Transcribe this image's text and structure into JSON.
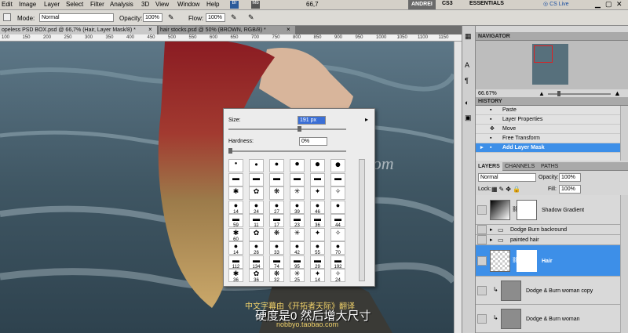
{
  "menu": [
    "Edit",
    "Image",
    "Layer",
    "Select",
    "Filter",
    "Analysis",
    "3D",
    "View",
    "Window",
    "Help"
  ],
  "app": {
    "zoom": "66,7",
    "workspace": "ANDREI",
    "cs3": "CS3",
    "essentials": "ESSENTIALS",
    "cslive": "CS Live"
  },
  "options": {
    "mode_label": "Mode:",
    "mode_value": "Normal",
    "opacity_label": "Opacity:",
    "opacity_value": "100%",
    "flow_label": "Flow:",
    "flow_value": "100%"
  },
  "tabs": [
    "opeless PSD BOX.psd @ 66,7% (Hair, Layer Mask/8) *",
    "hair stocks.psd @ 50% (BROWN, RGB/8) *"
  ],
  "ruler": [
    "100",
    "150",
    "200",
    "250",
    "300",
    "350",
    "400",
    "450",
    "500",
    "550",
    "600",
    "650",
    "700",
    "750",
    "800",
    "850",
    "900",
    "950",
    "1000",
    "1050",
    "1100",
    "1150"
  ],
  "navigator": {
    "title": "NAVIGATOR",
    "zoom": "66.67%"
  },
  "history": {
    "title": "HISTORY",
    "items": [
      "Paste",
      "Layer Properties",
      "Move",
      "Free Transform",
      "Add Layer Mask"
    ]
  },
  "layers": {
    "tabs": [
      "LAYERS",
      "CHANNELS",
      "PATHS"
    ],
    "blend": "Normal",
    "opacity_label": "Opacity:",
    "opacity_value": "100%",
    "lock_label": "Lock:",
    "fill_label": "Fill:",
    "fill_value": "100%",
    "items": [
      "Shadow Gradient",
      "Dodge Burn backround",
      "painted hair",
      "Hair",
      "Dodge & Burn woman copy",
      "Dodge & Burn woman"
    ]
  },
  "brush": {
    "size_label": "Size:",
    "size_value": "191 px",
    "hardness_label": "Hardness:",
    "hardness_value": "0%",
    "presets": [
      [
        "",
        "",
        "",
        "",
        "",
        ""
      ],
      [
        "",
        "",
        "",
        "",
        "",
        ""
      ],
      [
        "",
        "",
        "",
        "",
        "",
        ""
      ],
      [
        "14",
        "24",
        "27",
        "39",
        "46",
        ""
      ],
      [
        "59",
        "11",
        "17",
        "23",
        "36",
        "44"
      ],
      [
        "60",
        "",
        "",
        "",
        "",
        ""
      ],
      [
        "14",
        "26",
        "33",
        "42",
        "55",
        "70"
      ],
      [
        "112",
        "134",
        "74",
        "95",
        "29",
        "192"
      ],
      [
        "36",
        "36",
        "32",
        "25",
        "14",
        "24"
      ]
    ]
  },
  "watermark": "www.cgtsj.com",
  "subtitles": {
    "line1": "中文字幕由《开拓者天际》翻译",
    "line2": "硬度是0 然后增大尺寸",
    "line3": "nobbyo.taobao.com"
  }
}
